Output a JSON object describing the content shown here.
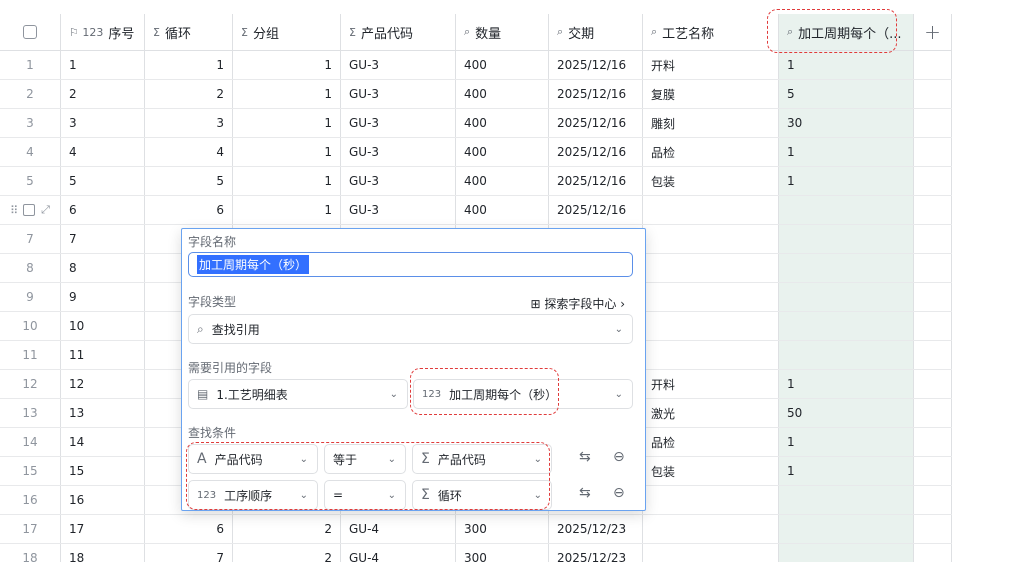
{
  "columns": {
    "idx": "",
    "seq_icon": "⚐ 123",
    "seq": "序号",
    "loop_icon": "Σ",
    "loop": "循环",
    "group_icon": "Σ",
    "group": "分组",
    "code_icon": "Σ",
    "code": "产品代码",
    "qty_icon": "⌕",
    "qty": "数量",
    "date_icon": "⌕",
    "date": "交期",
    "process_icon": "⌕",
    "process": "工艺名称",
    "cycle_icon": "⌕",
    "cycle": "加工周期每个（..."
  },
  "rows": [
    {
      "idx": "1",
      "seq": "1",
      "loop": "1",
      "group": "1",
      "code": "GU-3",
      "qty": "400",
      "date": "2025/12/16",
      "process": "开料",
      "cycle": "1"
    },
    {
      "idx": "2",
      "seq": "2",
      "loop": "2",
      "group": "1",
      "code": "GU-3",
      "qty": "400",
      "date": "2025/12/16",
      "process": "复膜",
      "cycle": "5"
    },
    {
      "idx": "3",
      "seq": "3",
      "loop": "3",
      "group": "1",
      "code": "GU-3",
      "qty": "400",
      "date": "2025/12/16",
      "process": "雕刻",
      "cycle": "30"
    },
    {
      "idx": "4",
      "seq": "4",
      "loop": "4",
      "group": "1",
      "code": "GU-3",
      "qty": "400",
      "date": "2025/12/16",
      "process": "品检",
      "cycle": "1"
    },
    {
      "idx": "5",
      "seq": "5",
      "loop": "5",
      "group": "1",
      "code": "GU-3",
      "qty": "400",
      "date": "2025/12/16",
      "process": "包装",
      "cycle": "1"
    },
    {
      "idx": "",
      "seq": "6",
      "loop": "6",
      "group": "1",
      "code": "GU-3",
      "qty": "400",
      "date": "2025/12/16",
      "process": "",
      "cycle": ""
    },
    {
      "idx": "7",
      "seq": "7",
      "loop": "",
      "group": "",
      "code": "",
      "qty": "",
      "date": "",
      "process": "",
      "cycle": ""
    },
    {
      "idx": "8",
      "seq": "8",
      "loop": "",
      "group": "",
      "code": "",
      "qty": "",
      "date": "",
      "process": "",
      "cycle": ""
    },
    {
      "idx": "9",
      "seq": "9",
      "loop": "",
      "group": "",
      "code": "",
      "qty": "",
      "date": "",
      "process": "",
      "cycle": ""
    },
    {
      "idx": "10",
      "seq": "10",
      "loop": "",
      "group": "",
      "code": "",
      "qty": "",
      "date": "",
      "process": "",
      "cycle": ""
    },
    {
      "idx": "11",
      "seq": "11",
      "loop": "",
      "group": "",
      "code": "",
      "qty": "",
      "date": "",
      "process": "",
      "cycle": ""
    },
    {
      "idx": "12",
      "seq": "12",
      "loop": "",
      "group": "",
      "code": "",
      "qty": "",
      "date": "",
      "process": "开料",
      "cycle": "1"
    },
    {
      "idx": "13",
      "seq": "13",
      "loop": "",
      "group": "",
      "code": "",
      "qty": "",
      "date": "",
      "process": "激光",
      "cycle": "50"
    },
    {
      "idx": "14",
      "seq": "14",
      "loop": "",
      "group": "",
      "code": "",
      "qty": "",
      "date": "",
      "process": "品检",
      "cycle": "1"
    },
    {
      "idx": "15",
      "seq": "15",
      "loop": "",
      "group": "",
      "code": "",
      "qty": "",
      "date": "",
      "process": "包装",
      "cycle": "1"
    },
    {
      "idx": "16",
      "seq": "16",
      "loop": "",
      "group": "",
      "code": "",
      "qty": "",
      "date": "",
      "process": "",
      "cycle": ""
    },
    {
      "idx": "17",
      "seq": "17",
      "loop": "6",
      "group": "2",
      "code": "GU-4",
      "qty": "300",
      "date": "2025/12/23",
      "process": "",
      "cycle": ""
    },
    {
      "idx": "18",
      "seq": "18",
      "loop": "7",
      "group": "2",
      "code": "GU-4",
      "qty": "300",
      "date": "2025/12/23",
      "process": "",
      "cycle": ""
    }
  ],
  "row6_tools": {
    "drag": "⠿",
    "expand": "⤢"
  },
  "add_column": "+",
  "popup": {
    "name_label": "字段名称",
    "name_value": "加工周期每个（秒）",
    "type_label": "字段类型",
    "explore_icon": "⊞",
    "explore": "探索字段中心",
    "explore_arrow": "›",
    "type_icon": "⌕",
    "type_value": "查找引用",
    "ref_label": "需要引用的字段",
    "table_icon": "▤",
    "ref_table": "1.工艺明细表",
    "ref_field_icon": "123",
    "ref_field": "加工周期每个（秒）",
    "cond_label": "查找条件",
    "conditions": [
      {
        "field_icon": "A",
        "field": "产品代码",
        "op": "等于",
        "value_icon": "Σ",
        "value": "产品代码"
      },
      {
        "field_icon": "123",
        "field": "工序顺序",
        "op": "=",
        "value_icon": "Σ",
        "value": "循环"
      }
    ],
    "swap_icon": "⇆",
    "remove_icon": "⊖",
    "chevron": "⌄"
  },
  "highlight_color": "#e03b3b",
  "accent_color": "#3370ff"
}
